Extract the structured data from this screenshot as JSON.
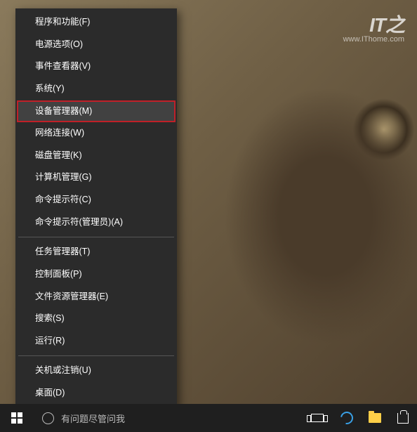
{
  "watermark": {
    "logo": "IT之",
    "sub": "www.IThome.com"
  },
  "menu": {
    "groups": [
      [
        {
          "label": "程序和功能(F)"
        },
        {
          "label": "电源选项(O)"
        },
        {
          "label": "事件查看器(V)"
        },
        {
          "label": "系统(Y)"
        },
        {
          "label": "设备管理器(M)",
          "highlight": true
        },
        {
          "label": "网络连接(W)"
        },
        {
          "label": "磁盘管理(K)"
        },
        {
          "label": "计算机管理(G)"
        },
        {
          "label": "命令提示符(C)"
        },
        {
          "label": "命令提示符(管理员)(A)"
        }
      ],
      [
        {
          "label": "任务管理器(T)"
        },
        {
          "label": "控制面板(P)"
        },
        {
          "label": "文件资源管理器(E)"
        },
        {
          "label": "搜索(S)"
        },
        {
          "label": "运行(R)"
        }
      ],
      [
        {
          "label": "关机或注销(U)"
        },
        {
          "label": "桌面(D)"
        }
      ]
    ]
  },
  "taskbar": {
    "search_placeholder": "有问题尽管问我"
  }
}
